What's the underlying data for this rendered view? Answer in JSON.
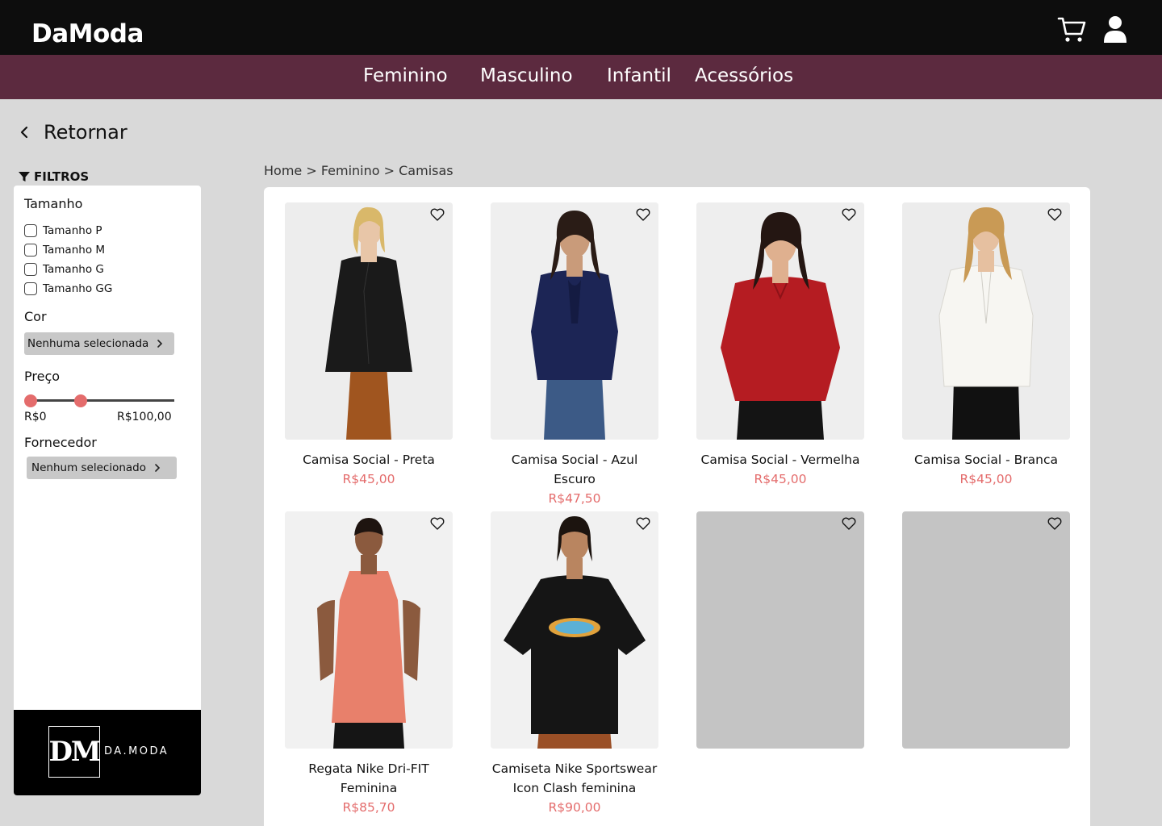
{
  "header": {
    "logo": "DaModa",
    "cart_icon": "cart-icon",
    "user_icon": "user-icon"
  },
  "nav": {
    "items": [
      "Feminino",
      "Masculino",
      "Infantil",
      "Acessórios"
    ],
    "background": "#5c2a3f"
  },
  "back": {
    "label": "Retornar"
  },
  "filters": {
    "title": "FILTROS",
    "size": {
      "title": "Tamanho",
      "options": [
        "Tamanho P",
        "Tamanho M",
        "Tamanho G",
        "Tamanho GG"
      ]
    },
    "color": {
      "title": "Cor",
      "value": "Nenhuma selecionada"
    },
    "price": {
      "title": "Preço",
      "min_label": "R$0",
      "max_label": "R$100,00"
    },
    "supplier": {
      "title": "Fornecedor",
      "value": "Nenhum selecionado"
    }
  },
  "brand": {
    "mark": "DM",
    "text": "DA.MODA"
  },
  "breadcrumb": "Home > Feminino > Camisas",
  "products": [
    {
      "name": "Camisa Social - Preta",
      "price": "R$45,00",
      "shirt_color": "#1a1a1a"
    },
    {
      "name": "Camisa Social - Azul Escuro",
      "price": "R$47,50",
      "shirt_color": "#1c2555"
    },
    {
      "name": "Camisa Social - Vermelha",
      "price": "R$45,00",
      "shirt_color": "#b51c22"
    },
    {
      "name": "Camisa Social - Branca",
      "price": "R$45,00",
      "shirt_color": "#f3f1ec"
    },
    {
      "name": "Regata Nike Dri-FIT Feminina",
      "price": "R$85,70",
      "shirt_color": "#e8806b"
    },
    {
      "name": "Camiseta Nike Sportswear Icon Clash feminina",
      "price": "R$90,00",
      "shirt_color": "#151515"
    },
    {
      "name": "",
      "price": ""
    },
    {
      "name": "",
      "price": ""
    }
  ],
  "colors": {
    "price": "#e46c6c",
    "accent": "#e46c6c",
    "topbar": "#0d0d0d"
  }
}
